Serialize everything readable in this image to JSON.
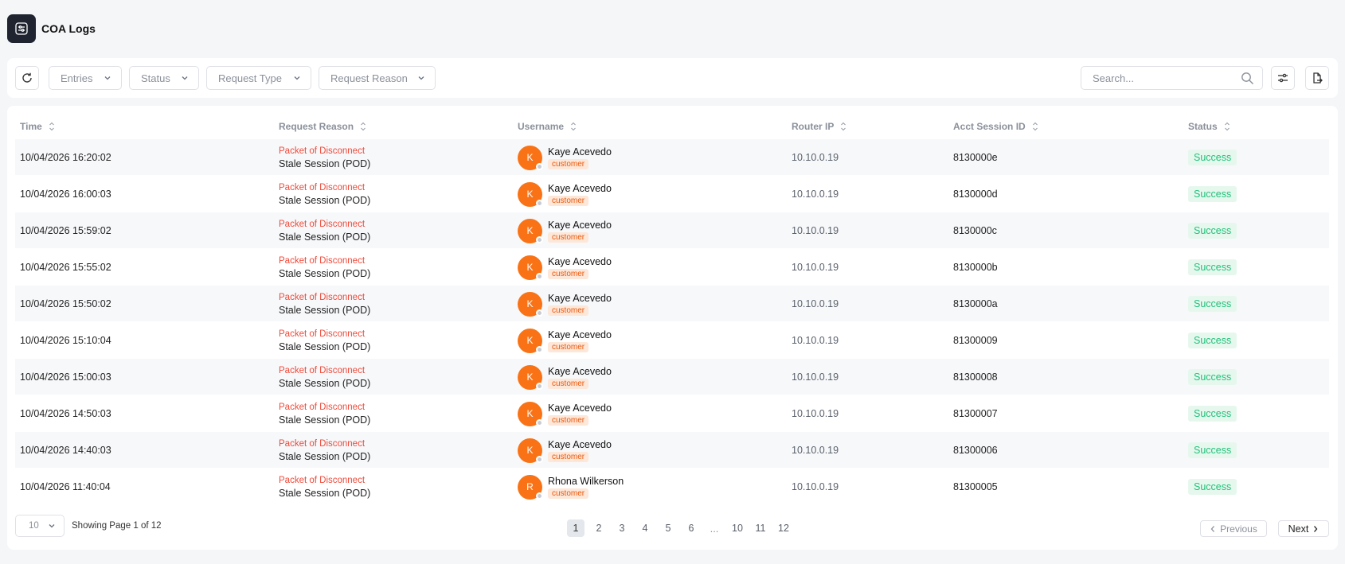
{
  "page": {
    "title": "COA Logs"
  },
  "toolbar": {
    "filters": [
      "Entries",
      "Status",
      "Request Type",
      "Request Reason"
    ],
    "search_placeholder": "Search..."
  },
  "table": {
    "columns": [
      "Time",
      "Request Reason",
      "Username",
      "Router IP",
      "Acct Session ID",
      "Status"
    ],
    "rows": [
      {
        "time": "10/04/2026 16:20:02",
        "reason_type": "Packet of Disconnect",
        "reason_detail": "Stale Session (POD)",
        "avatar": "K",
        "user": "Kaye Acevedo",
        "role": "customer",
        "ip": "10.10.0.19",
        "session": "8130000e",
        "status": "Success"
      },
      {
        "time": "10/04/2026 16:00:03",
        "reason_type": "Packet of Disconnect",
        "reason_detail": "Stale Session (POD)",
        "avatar": "K",
        "user": "Kaye Acevedo",
        "role": "customer",
        "ip": "10.10.0.19",
        "session": "8130000d",
        "status": "Success"
      },
      {
        "time": "10/04/2026 15:59:02",
        "reason_type": "Packet of Disconnect",
        "reason_detail": "Stale Session (POD)",
        "avatar": "K",
        "user": "Kaye Acevedo",
        "role": "customer",
        "ip": "10.10.0.19",
        "session": "8130000c",
        "status": "Success"
      },
      {
        "time": "10/04/2026 15:55:02",
        "reason_type": "Packet of Disconnect",
        "reason_detail": "Stale Session (POD)",
        "avatar": "K",
        "user": "Kaye Acevedo",
        "role": "customer",
        "ip": "10.10.0.19",
        "session": "8130000b",
        "status": "Success"
      },
      {
        "time": "10/04/2026 15:50:02",
        "reason_type": "Packet of Disconnect",
        "reason_detail": "Stale Session (POD)",
        "avatar": "K",
        "user": "Kaye Acevedo",
        "role": "customer",
        "ip": "10.10.0.19",
        "session": "8130000a",
        "status": "Success"
      },
      {
        "time": "10/04/2026 15:10:04",
        "reason_type": "Packet of Disconnect",
        "reason_detail": "Stale Session (POD)",
        "avatar": "K",
        "user": "Kaye Acevedo",
        "role": "customer",
        "ip": "10.10.0.19",
        "session": "81300009",
        "status": "Success"
      },
      {
        "time": "10/04/2026 15:00:03",
        "reason_type": "Packet of Disconnect",
        "reason_detail": "Stale Session (POD)",
        "avatar": "K",
        "user": "Kaye Acevedo",
        "role": "customer",
        "ip": "10.10.0.19",
        "session": "81300008",
        "status": "Success"
      },
      {
        "time": "10/04/2026 14:50:03",
        "reason_type": "Packet of Disconnect",
        "reason_detail": "Stale Session (POD)",
        "avatar": "K",
        "user": "Kaye Acevedo",
        "role": "customer",
        "ip": "10.10.0.19",
        "session": "81300007",
        "status": "Success"
      },
      {
        "time": "10/04/2026 14:40:03",
        "reason_type": "Packet of Disconnect",
        "reason_detail": "Stale Session (POD)",
        "avatar": "K",
        "user": "Kaye Acevedo",
        "role": "customer",
        "ip": "10.10.0.19",
        "session": "81300006",
        "status": "Success"
      },
      {
        "time": "10/04/2026 11:40:04",
        "reason_type": "Packet of Disconnect",
        "reason_detail": "Stale Session (POD)",
        "avatar": "R",
        "user": "Rhona Wilkerson",
        "role": "customer",
        "ip": "10.10.0.19",
        "session": "81300005",
        "status": "Success"
      }
    ]
  },
  "pagination": {
    "page_size": "10",
    "showing": "Showing Page 1 of 12",
    "pages": [
      "1",
      "2",
      "3",
      "4",
      "5",
      "6",
      "...",
      "10",
      "11",
      "12"
    ],
    "current": "1",
    "prev_label": "Previous",
    "next_label": "Next"
  },
  "colors": {
    "accent_orange": "#f97316",
    "reason_red": "#ef4a3a",
    "success_green": "#22c07a",
    "success_bg": "#e6f8ee"
  }
}
